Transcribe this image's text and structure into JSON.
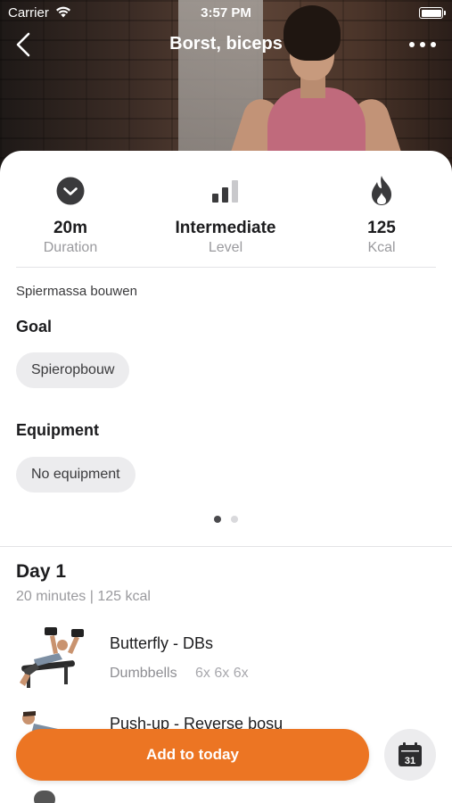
{
  "status_bar": {
    "carrier": "Carrier",
    "time": "3:57 PM"
  },
  "nav": {
    "title": "Borst, biceps"
  },
  "stats": [
    {
      "icon": "clock-icon",
      "value": "20m",
      "label": "Duration"
    },
    {
      "icon": "level-bars-icon",
      "value": "Intermediate",
      "label": "Level"
    },
    {
      "icon": "flame-icon",
      "value": "125",
      "label": "Kcal"
    }
  ],
  "description": "Spiermassa bouwen",
  "goal": {
    "title": "Goal",
    "chip": "Spieropbouw"
  },
  "equipment": {
    "title": "Equipment",
    "chip": "No equipment"
  },
  "pager": {
    "count": 2,
    "active": 0
  },
  "day": {
    "title": "Day 1",
    "meta": "20 minutes | 125 kcal",
    "exercises": [
      {
        "name": "Butterfly - DBs",
        "equipment": "Dumbbells",
        "sets": "6x 6x 6x"
      },
      {
        "name": "Push-up - Reverse bosu",
        "equipment": "",
        "sets": ""
      }
    ]
  },
  "actions": {
    "add_label": "Add to today",
    "calendar_day": "31"
  },
  "colors": {
    "accent": "#ec7523",
    "chip_bg": "#ececee",
    "muted_text": "#9a9a9e"
  }
}
